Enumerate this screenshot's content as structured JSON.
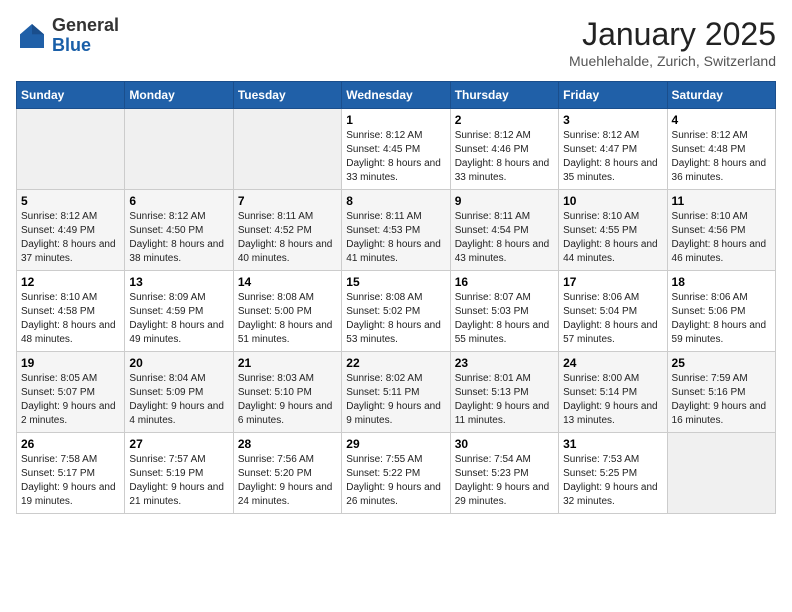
{
  "header": {
    "logo_general": "General",
    "logo_blue": "Blue",
    "month": "January 2025",
    "location": "Muehlehalde, Zurich, Switzerland"
  },
  "weekdays": [
    "Sunday",
    "Monday",
    "Tuesday",
    "Wednesday",
    "Thursday",
    "Friday",
    "Saturday"
  ],
  "weeks": [
    [
      null,
      null,
      null,
      {
        "day": 1,
        "sunrise": "8:12 AM",
        "sunset": "4:45 PM",
        "daylight": "8 hours and 33 minutes."
      },
      {
        "day": 2,
        "sunrise": "8:12 AM",
        "sunset": "4:46 PM",
        "daylight": "8 hours and 33 minutes."
      },
      {
        "day": 3,
        "sunrise": "8:12 AM",
        "sunset": "4:47 PM",
        "daylight": "8 hours and 35 minutes."
      },
      {
        "day": 4,
        "sunrise": "8:12 AM",
        "sunset": "4:48 PM",
        "daylight": "8 hours and 36 minutes."
      }
    ],
    [
      {
        "day": 5,
        "sunrise": "8:12 AM",
        "sunset": "4:49 PM",
        "daylight": "8 hours and 37 minutes."
      },
      {
        "day": 6,
        "sunrise": "8:12 AM",
        "sunset": "4:50 PM",
        "daylight": "8 hours and 38 minutes."
      },
      {
        "day": 7,
        "sunrise": "8:11 AM",
        "sunset": "4:52 PM",
        "daylight": "8 hours and 40 minutes."
      },
      {
        "day": 8,
        "sunrise": "8:11 AM",
        "sunset": "4:53 PM",
        "daylight": "8 hours and 41 minutes."
      },
      {
        "day": 9,
        "sunrise": "8:11 AM",
        "sunset": "4:54 PM",
        "daylight": "8 hours and 43 minutes."
      },
      {
        "day": 10,
        "sunrise": "8:10 AM",
        "sunset": "4:55 PM",
        "daylight": "8 hours and 44 minutes."
      },
      {
        "day": 11,
        "sunrise": "8:10 AM",
        "sunset": "4:56 PM",
        "daylight": "8 hours and 46 minutes."
      }
    ],
    [
      {
        "day": 12,
        "sunrise": "8:10 AM",
        "sunset": "4:58 PM",
        "daylight": "8 hours and 48 minutes."
      },
      {
        "day": 13,
        "sunrise": "8:09 AM",
        "sunset": "4:59 PM",
        "daylight": "8 hours and 49 minutes."
      },
      {
        "day": 14,
        "sunrise": "8:08 AM",
        "sunset": "5:00 PM",
        "daylight": "8 hours and 51 minutes."
      },
      {
        "day": 15,
        "sunrise": "8:08 AM",
        "sunset": "5:02 PM",
        "daylight": "8 hours and 53 minutes."
      },
      {
        "day": 16,
        "sunrise": "8:07 AM",
        "sunset": "5:03 PM",
        "daylight": "8 hours and 55 minutes."
      },
      {
        "day": 17,
        "sunrise": "8:06 AM",
        "sunset": "5:04 PM",
        "daylight": "8 hours and 57 minutes."
      },
      {
        "day": 18,
        "sunrise": "8:06 AM",
        "sunset": "5:06 PM",
        "daylight": "8 hours and 59 minutes."
      }
    ],
    [
      {
        "day": 19,
        "sunrise": "8:05 AM",
        "sunset": "5:07 PM",
        "daylight": "9 hours and 2 minutes."
      },
      {
        "day": 20,
        "sunrise": "8:04 AM",
        "sunset": "5:09 PM",
        "daylight": "9 hours and 4 minutes."
      },
      {
        "day": 21,
        "sunrise": "8:03 AM",
        "sunset": "5:10 PM",
        "daylight": "9 hours and 6 minutes."
      },
      {
        "day": 22,
        "sunrise": "8:02 AM",
        "sunset": "5:11 PM",
        "daylight": "9 hours and 9 minutes."
      },
      {
        "day": 23,
        "sunrise": "8:01 AM",
        "sunset": "5:13 PM",
        "daylight": "9 hours and 11 minutes."
      },
      {
        "day": 24,
        "sunrise": "8:00 AM",
        "sunset": "5:14 PM",
        "daylight": "9 hours and 13 minutes."
      },
      {
        "day": 25,
        "sunrise": "7:59 AM",
        "sunset": "5:16 PM",
        "daylight": "9 hours and 16 minutes."
      }
    ],
    [
      {
        "day": 26,
        "sunrise": "7:58 AM",
        "sunset": "5:17 PM",
        "daylight": "9 hours and 19 minutes."
      },
      {
        "day": 27,
        "sunrise": "7:57 AM",
        "sunset": "5:19 PM",
        "daylight": "9 hours and 21 minutes."
      },
      {
        "day": 28,
        "sunrise": "7:56 AM",
        "sunset": "5:20 PM",
        "daylight": "9 hours and 24 minutes."
      },
      {
        "day": 29,
        "sunrise": "7:55 AM",
        "sunset": "5:22 PM",
        "daylight": "9 hours and 26 minutes."
      },
      {
        "day": 30,
        "sunrise": "7:54 AM",
        "sunset": "5:23 PM",
        "daylight": "9 hours and 29 minutes."
      },
      {
        "day": 31,
        "sunrise": "7:53 AM",
        "sunset": "5:25 PM",
        "daylight": "9 hours and 32 minutes."
      },
      null
    ]
  ]
}
